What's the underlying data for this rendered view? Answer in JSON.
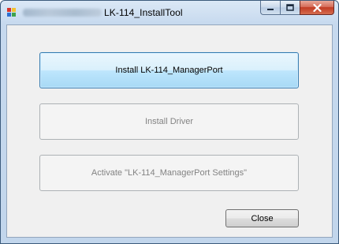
{
  "window": {
    "title": "LK-114_InstallTool",
    "blurred_prefix": ""
  },
  "caption": {
    "minimize_glyph": "▁",
    "maximize_glyph": "□",
    "close_glyph": "✕"
  },
  "buttons": {
    "install_manager": "Install LK-114_ManagerPort",
    "install_driver": "Install Driver",
    "activate_settings": "Activate \"LK-114_ManagerPort Settings\"",
    "close": "Close"
  },
  "colors": {
    "icon_red": "#d8322a",
    "icon_yellow": "#f2c12e",
    "icon_blue": "#2c6fd1",
    "icon_green": "#3fa34d"
  }
}
